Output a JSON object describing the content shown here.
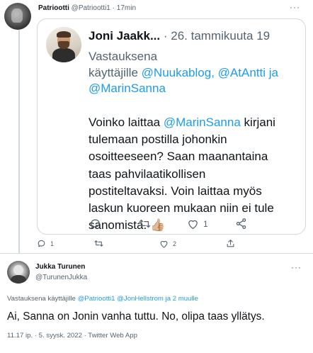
{
  "top_tweet": {
    "name": "Patriootti",
    "handle": "@Patriootti1",
    "separator": "·",
    "time": "17min",
    "more": "···",
    "quote": {
      "name": "Joni Jaakk...",
      "separator": "·",
      "date": "26. tammikuuta 19",
      "replying_prefix": "Vastauksena",
      "replying_to_word": "käyttäjille",
      "mention_1": "@Nuukablog,",
      "mention_2": "@AtAntti",
      "and_word": "ja",
      "mention_3": "@MarinSanna",
      "body_line1_a": "Voinko laittaa",
      "body_line1_mention": "@MarinSanna",
      "body_line1_b": "kirjani",
      "body_line2": "tulemaan postilla johonkin",
      "body_line3": "osoitteeseen? Saan maanantaina",
      "body_line4": "taas pahvilaatikollisen",
      "body_line5": "postiteltavaksi. Voin laittaa myös",
      "body_line6": "laskun kuoreen mukaan niin ei tule",
      "body_line7": "sanomista.",
      "emoji": "👍🏼",
      "actions": {
        "reply": "",
        "retweet": "",
        "like": "1",
        "share": ""
      }
    },
    "actions": {
      "reply": "1",
      "retweet": "",
      "like": "2",
      "share": ""
    }
  },
  "reply_tweet": {
    "name": "Jukka Turunen",
    "handle": "@TurunenJukka",
    "more": "···",
    "replying_prefix": "Vastauksena käyttäjille",
    "mention_1": "@Patriootti1",
    "mention_2": "@JonHellstrom",
    "and_more": "ja 2 muulle",
    "text": "Ai, Sanna on Jonin vanha tuttu. No, olipa taas yllätys.",
    "meta": "11.17 ip. · 5. syysk. 2022 · Twitter Web App"
  },
  "colors": {
    "accent": "#1d9bf0",
    "text": "#0f1419",
    "muted": "#536471",
    "border": "#cfd9de"
  }
}
